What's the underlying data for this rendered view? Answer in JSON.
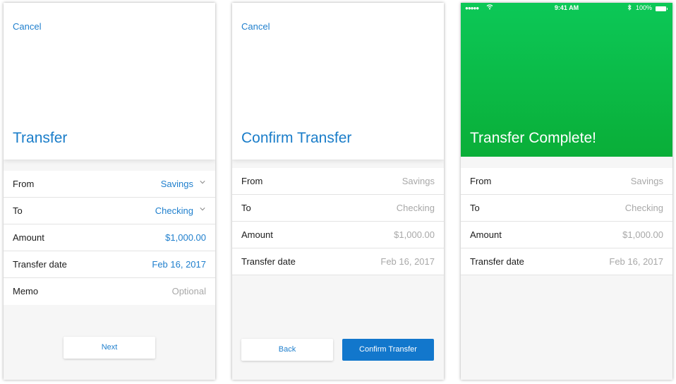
{
  "screens": [
    {
      "cancel": "Cancel",
      "title": "Transfer",
      "rows": [
        {
          "label": "From",
          "value": "Savings",
          "dropdown": true
        },
        {
          "label": "To",
          "value": "Checking",
          "dropdown": true
        },
        {
          "label": "Amount",
          "value": "$1,000.00"
        },
        {
          "label": "Transfer date",
          "value": "Feb 16, 2017"
        },
        {
          "label": "Memo",
          "placeholder": "Optional"
        }
      ],
      "next_label": "Next"
    },
    {
      "cancel": "Cancel",
      "title": "Confirm Transfer",
      "rows": [
        {
          "label": "From",
          "value": "Savings"
        },
        {
          "label": "To",
          "value": "Checking"
        },
        {
          "label": "Amount",
          "value": "$1,000.00"
        },
        {
          "label": "Transfer date",
          "value": "Feb 16, 2017"
        }
      ],
      "back_label": "Back",
      "confirm_label": "Confirm Transfer"
    },
    {
      "status_bar": {
        "time": "9:41 AM",
        "battery": "100%",
        "signal_icon": "signal-dots-icon",
        "wifi_icon": "wifi-icon",
        "bluetooth_icon": "bluetooth-icon",
        "battery_icon": "battery-icon"
      },
      "title": "Transfer Complete!",
      "rows": [
        {
          "label": "From",
          "value": "Savings"
        },
        {
          "label": "To",
          "value": "Checking"
        },
        {
          "label": "Amount",
          "value": "$1,000.00"
        },
        {
          "label": "Transfer date",
          "value": "Feb 16, 2017"
        }
      ]
    }
  ],
  "colors": {
    "accent": "#1f7fcd",
    "primary_button": "#1277cc",
    "success_green": "#0aae38",
    "muted_text": "#a8a8a8",
    "background": "#f6f6f6"
  }
}
